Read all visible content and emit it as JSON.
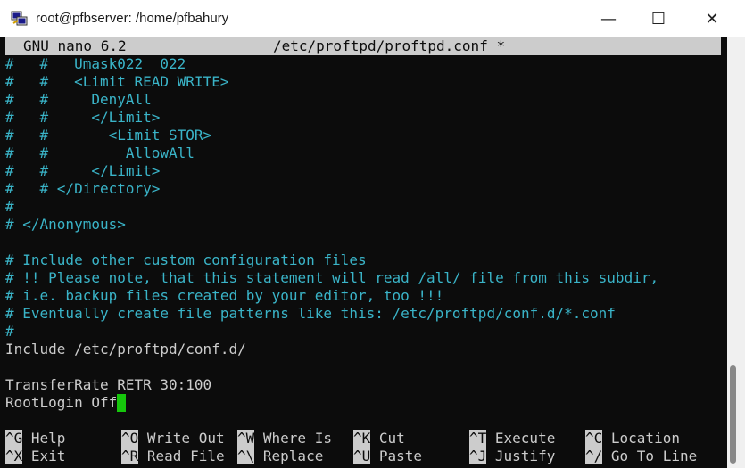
{
  "window": {
    "title": "root@pfbserver: /home/pfbahury",
    "minimize_glyph": "—",
    "maximize_glyph": "☐",
    "close_glyph": "✕"
  },
  "nano": {
    "version": "GNU nano 6.2",
    "filename": "/etc/proftpd/proftpd.conf *"
  },
  "lines": [
    {
      "text": "#   #   Umask022  022",
      "type": "comment"
    },
    {
      "text": "#   #   <Limit READ WRITE>",
      "type": "comment"
    },
    {
      "text": "#   #     DenyAll",
      "type": "comment"
    },
    {
      "text": "#   #     </Limit>",
      "type": "comment"
    },
    {
      "text": "#   #       <Limit STOR>",
      "type": "comment"
    },
    {
      "text": "#   #         AllowAll",
      "type": "comment"
    },
    {
      "text": "#   #     </Limit>",
      "type": "comment"
    },
    {
      "text": "#   # </Directory>",
      "type": "comment"
    },
    {
      "text": "#",
      "type": "comment"
    },
    {
      "text": "# </Anonymous>",
      "type": "comment"
    },
    {
      "text": "",
      "type": "plain"
    },
    {
      "text": "# Include other custom configuration files",
      "type": "comment"
    },
    {
      "text": "# !! Please note, that this statement will read /all/ file from this subdir,",
      "type": "comment"
    },
    {
      "text": "# i.e. backup files created by your editor, too !!!",
      "type": "comment"
    },
    {
      "text": "# Eventually create file patterns like this: /etc/proftpd/conf.d/*.conf",
      "type": "comment"
    },
    {
      "text": "#",
      "type": "comment"
    },
    {
      "text": "Include /etc/proftpd/conf.d/",
      "type": "plain"
    },
    {
      "text": "",
      "type": "plain"
    },
    {
      "text": "TransferRate RETR 30:100",
      "type": "plain"
    },
    {
      "text": "RootLogin Off",
      "type": "plain"
    }
  ],
  "shortcuts": [
    {
      "key": "^G",
      "label": " Help"
    },
    {
      "key": "^O",
      "label": " Write Out"
    },
    {
      "key": "^W",
      "label": " Where Is"
    },
    {
      "key": "^K",
      "label": " Cut"
    },
    {
      "key": "^T",
      "label": " Execute"
    },
    {
      "key": "^C",
      "label": " Location"
    },
    {
      "key": "^X",
      "label": " Exit"
    },
    {
      "key": "^R",
      "label": " Read File"
    },
    {
      "key": "^\\",
      "label": " Replace"
    },
    {
      "key": "^U",
      "label": " Paste"
    },
    {
      "key": "^J",
      "label": " Justify"
    },
    {
      "key": "^/",
      "label": " Go To Line"
    }
  ],
  "colors": {
    "comment": "#3ab4c8",
    "cursor": "#16c60c",
    "terminal_bg": "#0c0c0c"
  }
}
